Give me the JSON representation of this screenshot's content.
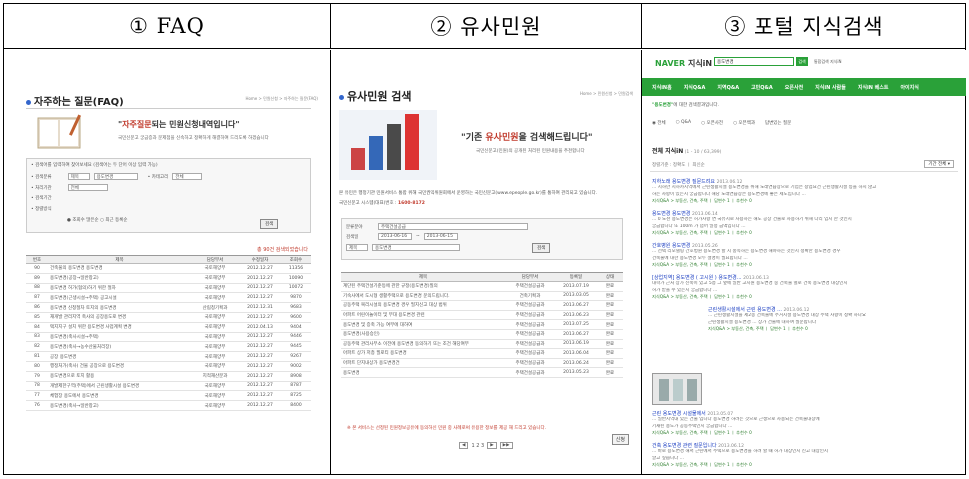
{
  "headers": [
    "① FAQ",
    "② 유사민원",
    "③ 포털 지식검색"
  ],
  "faq": {
    "title": "자주하는 질문(FAQ)",
    "breadcrumb": "Home > 민원신청 > 자주하는 질문(FAQ)",
    "slogan_pre": "\"",
    "slogan_em": "자주질문",
    "slogan_post": "되는 민원신청내역입니다\"",
    "sub": "국민신문고 궁금증과 문제점을 신속하고 정확하게 해결하여 드리도록 하겠습니다",
    "search": {
      "intro": "• 검색어를 입력하여 찾아보세요 (검색어는 두 단어 이상 입력 가능)",
      "label_field": "• 검색분류",
      "field_value": "제목",
      "keyword_value": "용도변경",
      "label_cat": "• 카테고리",
      "cat_value": "전체",
      "label_org": "• 처리기관",
      "org_value": "전체",
      "label_period": "• 검색기간",
      "label_sort": "• 정렬방식",
      "sort_value": "● 조회수 많은순  ○ 최근 등록순",
      "button": "검색"
    },
    "count_text": "총 90건 검색되었습니다",
    "columns": [
      "번호",
      "제목",
      "담당부서",
      "수정일자",
      "조회수"
    ],
    "rows": [
      [
        "90",
        "건축물의 용도변경 용도변경",
        "국토해양부",
        "2012.12.27",
        "11356"
      ],
      [
        "89",
        "용도변경(공장→일반창고)",
        "국토해양부",
        "2012.12.27",
        "10090"
      ],
      [
        "88",
        "용도변경 허가(협의)하기 위한 절차",
        "국토해양부",
        "2012.12.27",
        "10072"
      ],
      [
        "87",
        "용도변경(근생시설→주택) 공고시설",
        "국토해양부",
        "2012.12.27",
        "9870"
      ],
      [
        "86",
        "용도변경 신청절차 토지의 용도변경",
        "산림청기획과",
        "2012.12.31",
        "9683"
      ],
      [
        "85",
        "재개발 관리지역 축사의 공장용도로 변경",
        "국토해양부",
        "2012.12.27",
        "9600"
      ],
      [
        "84",
        "택지지구 설치 위한 용도변경 사업계획 변경",
        "국토해양부",
        "2012.04.13",
        "9404"
      ],
      [
        "83",
        "용도변경(축사시설→주택)",
        "국토해양부",
        "2012.12.27",
        "9446"
      ],
      [
        "82",
        "용도변경(축사→농수산물처리장)",
        "국토해양부",
        "2012.12.27",
        "9445"
      ],
      [
        "81",
        "공장 용도변경",
        "국토해양부",
        "2012.12.27",
        "9267"
      ],
      [
        "80",
        "행정처가(축사) 건물 공장으로 용도변경",
        "국토해양부",
        "2012.12.27",
        "9002"
      ],
      [
        "79",
        "용도변경으로 토지 활용",
        "지적재산분과",
        "2012.12.27",
        "8908"
      ],
      [
        "78",
        "개발제한구역(주택)에서 근린생활시설 용도변경",
        "국토해양부",
        "2012.12.27",
        "8787"
      ],
      [
        "77",
        "체험장 용도에서 용도변경",
        "국토해양부",
        "2012.12.27",
        "8725"
      ],
      [
        "76",
        "용도변경(축사→일반창고)",
        "국토해양부",
        "2012.12.27",
        "8400"
      ]
    ]
  },
  "similar": {
    "title": "유사민원 검색",
    "breadcrumb": "Home > 민원신청 > 민원검색",
    "slogan_pre": "\"기존 ",
    "slogan_em": "유사민원",
    "slogan_post": "을 검색해드립니다\"",
    "sub": "국민신문고(민원)의 공개된 처리된 민원내용을 추천합니다",
    "notice1": "본 유민은 행정기관 민원서비스 통합 위해 국민권익위원회에서 운영하는 국민신문고(www.epeople.go.kr)를 통하여 관리되고 있습니다.",
    "notice2_pre": "국민신문고 시스템(대표)번호 : ",
    "notice2_num": "1600-8172",
    "search": {
      "label_cat": "분류분야",
      "cat_value": "주택건설공급",
      "label_period": "검색일",
      "date_from": "2013-06-16",
      "date_to": "2013-06-15",
      "field_value": "제목",
      "keyword_value": "용도변경",
      "button": "검색"
    },
    "columns": [
      "제목",
      "담당부서",
      "등록일",
      "상태"
    ],
    "rows": [
      [
        "계단된 주택건설기준등에 관한 규정(용도변경)질의",
        "주택건설공급과",
        "2013.07.19",
        "완료"
      ],
      [
        "기숙사에서 도시형 생활주택으로 용도변경 문의드립니다.",
        "건축기획과",
        "2013.03.05",
        "완료"
      ],
      [
        "공동주택 복리시설의 용도변경 경우 필지신고 대상 범위",
        "주택건설공급과",
        "2013.06.27",
        "완료"
      ],
      [
        "아파트 어린이놀이터 및 부대 용도변경 관련",
        "주택건설공급과",
        "2013.06.23",
        "완료"
      ],
      [
        "용도변경 및 증축 가능 여부에 대하여",
        "주택건설공급과",
        "2013.07.25",
        "완료"
      ],
      [
        "용도변경(사용승인)",
        "주택건설공급과",
        "2013.06.27",
        "완료"
      ],
      [
        "공동주택 관리사무소 이전에 용도변경 동의하기 또는 조건 해당여부",
        "주택건설공급과",
        "2013.06.19",
        "완료"
      ],
      [
        "아파트 상가 저층 필로티 용도변경",
        "주택건설공급과",
        "2013.06.04",
        "완료"
      ],
      [
        "아파트 단지내상가 용도변경건",
        "주택건설공급과",
        "2013.06.24",
        "완료"
      ],
      [
        "용도변경",
        "주택건설공급과",
        "2013.05.23",
        "완료"
      ]
    ],
    "warning": "※ 본 서비스는 선정된 민원정보공유에 동의하신 민원 중 사례로써 유용한 정보를 제공 해 드리고 있습니다.",
    "pager": {
      "first": "◀",
      "pages": "1 2 3",
      "next": "▶",
      "last": "▶▶"
    },
    "apply_button": "신청"
  },
  "portal": {
    "logo_naver": "NAVER",
    "logo_kin": " 지식iN",
    "search_value": "용도변경",
    "search_button": "검색",
    "top_links": "통합검색   지식iN",
    "menu": [
      "지식iN홈",
      "지식Q&A",
      "지역Q&A",
      "고민Q&A",
      "오픈사전",
      "지식iN 사람들",
      "지식iN 베스트",
      "아이지식"
    ],
    "related_em": "\"용도변경\"",
    "related_rest": "에 대한 검색결과입니다.",
    "tabs": [
      "◉ 전체",
      "○ Q&A",
      "○ 오픈사전",
      "○ 오픈백과",
      "답변있는 질문"
    ],
    "result_title": "전체 지식iN",
    "result_count": " (1 - 10 / 63,399)",
    "sort": "정렬기준 : 정확도 ㅣ 최신순",
    "period": "기간 전체 ▾",
    "items": [
      {
        "h": "지하노래 용도변경 질문드려요",
        "date": "2013.06.12",
        "b1": "... 지하만 지하카지역에서 근린생활시설 용도변경을 위해 노래연습장으로 기업은 창업요건 근린생활시설 등을 하지 않고",
        "b2": "하는 사항이 있는지 궁금합니다 해당 노래연습장은 용도변경에 좋은 제도입니다 ...",
        "m": "지식Q&A > 부동산, 건축, 주택 ㅣ 답변수 1 ㅣ 추천수 0"
      },
      {
        "h": "용도변경 용도변경",
        "date": "2013.06.14",
        "b1": "... 0 노천 용도변경은 허가사항 면 국유지로 사용하는 해도 공장 건물로 사용하기 위해 다리 입지 한 것인지",
        "b2": "궁금합니다 또 100m 가 넘어 일정 금액입니다 ...",
        "m": "지식Q&A > 부동산, 건축, 주택 ㅣ 답변수 1 ㅣ 추천수 0"
      },
      {
        "h": "간호병원 용도변경",
        "date": "2013.05.26",
        "b1": "... 선택 리모델링 간호병원 용도변경 할 시 충족하는 용도변경 해야하는 것인지 정확한 용도변경 경우",
        "b2": "건축물에 대한 용도변경 모두 설명이 필요합니다 ...",
        "m": "지식Q&A > 부동산, 건축, 주택 ㅣ 답변수 1 ㅣ 추천수 0"
      },
      {
        "h": "[상업지역] 용도변경 ( 고시원 ) 용도변경...",
        "date": "2013.06.13",
        "b1": "대학가 근처 상가 신축이 있고 5층 그 옆에 일반 고시원 용도변경 중 건축물 별로 건축 용도변경 대상인지",
        "b2": "허가 받을 수 있는지 궁금합니다 ...",
        "m": "지식Q&A > 부동산, 건축, 주택 ㅣ 답변수 1 ㅣ 추천수 0"
      },
      {
        "h": "근린생활시설에서 근린 용도변경 ...",
        "date": "2013.06.12",
        "b1": "... 근린생활시설을 제2종 건축물에 주거시설 용도변경 대상 주택 사항이 정확 하나요",
        "b2": "근린생활시설 용도변경 ... 상가 건물에 대하여 질문합니다",
        "m": "지식Q&A > 부동산, 건축, 주택 ㅣ 답변수 1 ㅣ 추천수 0"
      },
      {
        "h": "근린 용도변경 시설물에서",
        "date": "2013.05.07",
        "b1": "... 일반지역내 있는 건물 입니다 용도변경 하려는 것으로 근생으로 사용되는 건축물대장에",
        "b2": "기재된 용도가 공동주택인지 궁금합니다 ...",
        "m": "지식Q&A > 부동산, 건축, 주택 ㅣ 답변수 1 ㅣ 추천수 0"
      },
      {
        "h": "건축 용도변경 관련 질문입니다",
        "date": "2013.06.12",
        "b1": "... 바로 용도변경 해서 근린에서 주택으로 용도변경을 하려 할 때 허가 대상인지 신고 대상인지",
        "b2": "알고 싶습니다 ...",
        "m": "지식Q&A > 부동산, 건축, 주택 ㅣ 답변수 1 ㅣ 추천수 0"
      }
    ]
  }
}
